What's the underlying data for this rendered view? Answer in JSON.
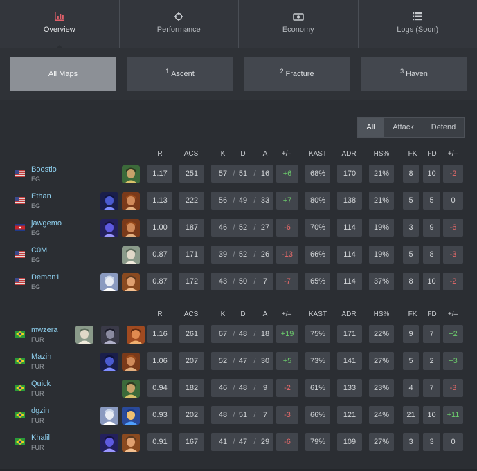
{
  "nav": {
    "tabs": [
      {
        "label": "Overview",
        "icon": "bar-chart-icon",
        "active": true
      },
      {
        "label": "Performance",
        "icon": "crosshair-icon",
        "active": false
      },
      {
        "label": "Economy",
        "icon": "money-icon",
        "active": false
      },
      {
        "label": "Logs (Soon)",
        "icon": "list-icon",
        "active": false
      }
    ]
  },
  "maps": [
    {
      "num": "",
      "label": "All Maps",
      "active": true
    },
    {
      "num": "1",
      "label": "Ascent",
      "active": false
    },
    {
      "num": "2",
      "label": "Fracture",
      "active": false
    },
    {
      "num": "3",
      "label": "Haven",
      "active": false
    }
  ],
  "filter": {
    "all": "All",
    "attack": "Attack",
    "defend": "Defend"
  },
  "columns": {
    "r": "R",
    "acs": "ACS",
    "k": "K",
    "d": "D",
    "a": "A",
    "pm": "+/–",
    "kast": "KAST",
    "adr": "ADR",
    "hs": "HS%",
    "fk": "FK",
    "fd": "FD",
    "fpm": "+/–"
  },
  "colors": {
    "positive": "#6ccb6c",
    "negative": "#e86a6a",
    "name": "#8fd1f0"
  },
  "team1": [
    {
      "name": "Boostio",
      "team": "EG",
      "flag": "us",
      "agents": [
        "skye"
      ],
      "r": "1.17",
      "acs": "251",
      "k": "57",
      "d": "51",
      "a": "16",
      "pm": "+6",
      "pm_sign": "pos",
      "kast": "68%",
      "adr": "170",
      "hs": "21%",
      "fk": "8",
      "fd": "10",
      "fpm": "-2",
      "fpm_sign": "neg"
    },
    {
      "name": "Ethan",
      "team": "EG",
      "flag": "us",
      "agents": [
        "omen",
        "breach"
      ],
      "r": "1.13",
      "acs": "222",
      "k": "56",
      "d": "49",
      "a": "33",
      "pm": "+7",
      "pm_sign": "pos",
      "kast": "80%",
      "adr": "138",
      "hs": "21%",
      "fk": "5",
      "fd": "5",
      "fpm": "0",
      "fpm_sign": "zero"
    },
    {
      "name": "jawgemo",
      "team": "EG",
      "flag": "kh",
      "agents": [
        "omen2",
        "breach"
      ],
      "r": "1.00",
      "acs": "187",
      "k": "46",
      "d": "52",
      "a": "27",
      "pm": "-6",
      "pm_sign": "neg",
      "kast": "70%",
      "adr": "114",
      "hs": "19%",
      "fk": "3",
      "fd": "9",
      "fpm": "-6",
      "fpm_sign": "neg"
    },
    {
      "name": "C0M",
      "team": "EG",
      "flag": "us",
      "agents": [
        "chamber"
      ],
      "r": "0.87",
      "acs": "171",
      "k": "39",
      "d": "52",
      "a": "26",
      "pm": "-13",
      "pm_sign": "neg",
      "kast": "66%",
      "adr": "114",
      "hs": "19%",
      "fk": "5",
      "fd": "8",
      "fpm": "-3",
      "fpm_sign": "neg"
    },
    {
      "name": "Demon1",
      "team": "EG",
      "flag": "us",
      "agents": [
        "jett",
        "sova"
      ],
      "r": "0.87",
      "acs": "172",
      "k": "43",
      "d": "50",
      "a": "7",
      "pm": "-7",
      "pm_sign": "neg",
      "kast": "65%",
      "adr": "114",
      "hs": "37%",
      "fk": "8",
      "fd": "10",
      "fpm": "-2",
      "fpm_sign": "neg"
    }
  ],
  "team2": [
    {
      "name": "mwzera",
      "team": "FUR",
      "flag": "br",
      "agents": [
        "chamber",
        "fade",
        "raze"
      ],
      "r": "1.16",
      "acs": "261",
      "k": "67",
      "d": "48",
      "a": "18",
      "pm": "+19",
      "pm_sign": "pos",
      "kast": "75%",
      "adr": "171",
      "hs": "22%",
      "fk": "9",
      "fd": "7",
      "fpm": "+2",
      "fpm_sign": "pos"
    },
    {
      "name": "Mazin",
      "team": "FUR",
      "flag": "br",
      "agents": [
        "omen",
        "breach"
      ],
      "r": "1.06",
      "acs": "207",
      "k": "52",
      "d": "47",
      "a": "30",
      "pm": "+5",
      "pm_sign": "pos",
      "kast": "73%",
      "adr": "141",
      "hs": "27%",
      "fk": "5",
      "fd": "2",
      "fpm": "+3",
      "fpm_sign": "pos"
    },
    {
      "name": "Quick",
      "team": "FUR",
      "flag": "br",
      "agents": [
        "skye"
      ],
      "r": "0.94",
      "acs": "182",
      "k": "46",
      "d": "48",
      "a": "9",
      "pm": "-2",
      "pm_sign": "neg",
      "kast": "61%",
      "adr": "133",
      "hs": "23%",
      "fk": "4",
      "fd": "7",
      "fpm": "-3",
      "fpm_sign": "neg"
    },
    {
      "name": "dgzin",
      "team": "FUR",
      "flag": "br",
      "agents": [
        "jett",
        "neon"
      ],
      "r": "0.93",
      "acs": "202",
      "k": "48",
      "d": "51",
      "a": "7",
      "pm": "-3",
      "pm_sign": "neg",
      "kast": "66%",
      "adr": "121",
      "hs": "24%",
      "fk": "21",
      "fd": "10",
      "fpm": "+11",
      "fpm_sign": "pos"
    },
    {
      "name": "Khalil",
      "team": "FUR",
      "flag": "br",
      "agents": [
        "omen2",
        "sova"
      ],
      "r": "0.91",
      "acs": "167",
      "k": "41",
      "d": "47",
      "a": "29",
      "pm": "-6",
      "pm_sign": "neg",
      "kast": "79%",
      "adr": "109",
      "hs": "27%",
      "fk": "3",
      "fd": "3",
      "fpm": "0",
      "fpm_sign": "zero"
    }
  ]
}
